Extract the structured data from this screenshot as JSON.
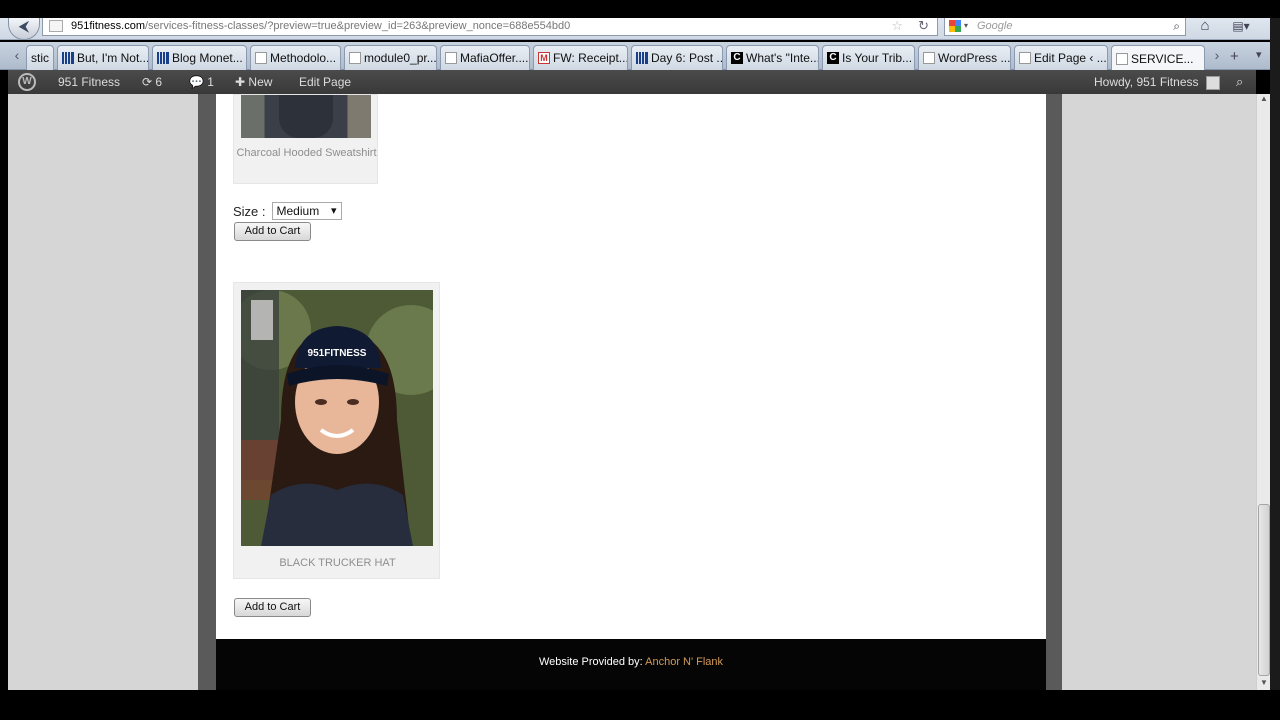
{
  "browser": {
    "url_domain": "951fitness.com",
    "url_rest": "/services-fitness-classes/?preview=true&preview_id=263&preview_nonce=688e554bd0",
    "search_placeholder": "Google",
    "tabs": [
      {
        "label": "stic",
        "icon": "blank-icon"
      },
      {
        "label": "But, I'm Not...",
        "icon": "bars-icon"
      },
      {
        "label": "Blog Monet...",
        "icon": "bars-icon"
      },
      {
        "label": "Methodolo...",
        "icon": "blank-icon"
      },
      {
        "label": "module0_pr...",
        "icon": "blank-icon"
      },
      {
        "label": "MafiaOffer....",
        "icon": "blank-icon"
      },
      {
        "label": "FW: Receipt...",
        "icon": "gmail-icon"
      },
      {
        "label": "Day 6: Post ...",
        "icon": "bars-icon"
      },
      {
        "label": "What's \"Inte...",
        "icon": "c-icon"
      },
      {
        "label": "Is Your Trib...",
        "icon": "c-icon"
      },
      {
        "label": "WordPress ...",
        "icon": "blank-icon"
      },
      {
        "label": "Edit Page ‹ ...",
        "icon": "blank-icon"
      },
      {
        "label": "SERVICE...",
        "icon": "blank-icon",
        "active": true
      }
    ]
  },
  "wp_admin_bar": {
    "site_name": "951 Fitness",
    "updates_count": "6",
    "comments_count": "1",
    "new_label": "New",
    "edit_label": "Edit Page",
    "howdy": "Howdy, 951 Fitness"
  },
  "products": [
    {
      "caption": "Charcoal Hooded Sweatshirt",
      "size_label": "Size :",
      "size_value": "Medium",
      "button": "Add to Cart"
    },
    {
      "caption": "BLACK TRUCKER HAT",
      "hat_text": "951FITNESS",
      "button": "Add to Cart"
    }
  ],
  "footer": {
    "prefix": "Website Provided by: ",
    "link": "Anchor N' Flank"
  },
  "colors": {
    "admin_bar": "#464646",
    "footer_bg": "#050505",
    "footer_link": "#d49a55",
    "caption": "#8e8e8e"
  }
}
